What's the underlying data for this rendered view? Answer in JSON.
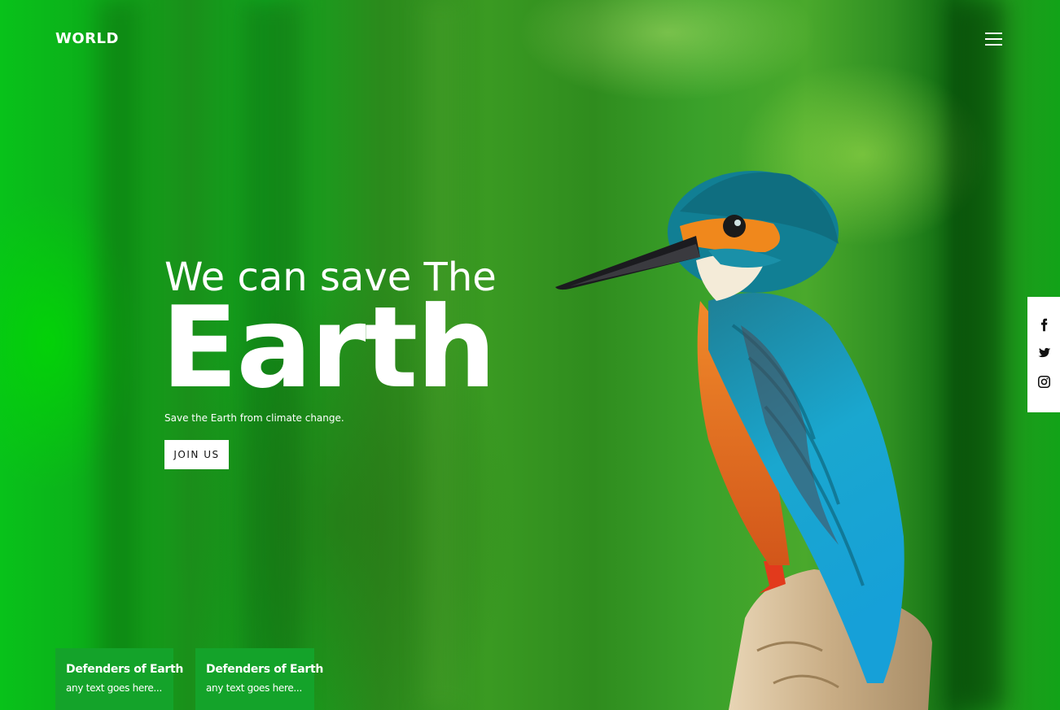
{
  "header": {
    "logo": "WORLD",
    "menu_icon": "hamburger-menu-icon"
  },
  "hero": {
    "eyebrow": "We can save The",
    "headline": "Earth",
    "tagline": "Save the Earth from climate change.",
    "cta_label": "JOIN US",
    "image": "kingfisher-bird-photo"
  },
  "social": {
    "items": [
      {
        "icon": "facebook-icon"
      },
      {
        "icon": "twitter-icon"
      },
      {
        "icon": "instagram-icon"
      }
    ]
  },
  "cards": [
    {
      "title": "Defenders of Earth",
      "text": "any text goes here..."
    },
    {
      "title": "Defenders of Earth",
      "text": "any text goes here..."
    }
  ],
  "colors": {
    "background": "#1f9a1c",
    "card": "#14a32a",
    "text": "#ffffff",
    "button_bg": "#ffffff",
    "button_text": "#111111"
  }
}
